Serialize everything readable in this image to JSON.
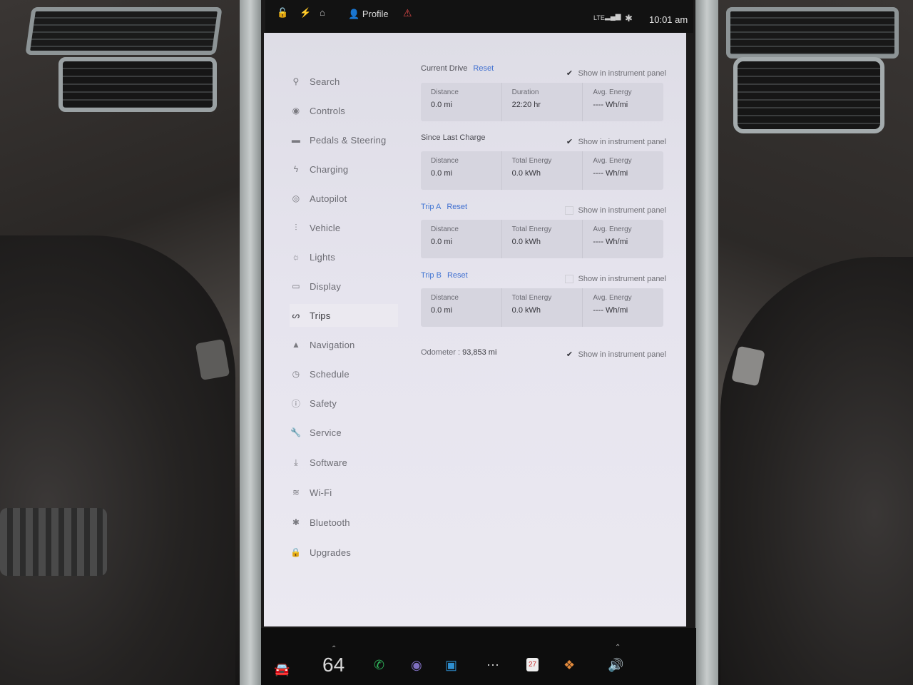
{
  "status_bar": {
    "profile_label": "Profile",
    "network": "LTE",
    "time": "10:01 am"
  },
  "sidebar": {
    "items": [
      {
        "label": "Search",
        "icon": "search-icon"
      },
      {
        "label": "Controls",
        "icon": "toggle-icon"
      },
      {
        "label": "Pedals & Steering",
        "icon": "car-icon"
      },
      {
        "label": "Charging",
        "icon": "bolt-icon"
      },
      {
        "label": "Autopilot",
        "icon": "steering-wheel-icon"
      },
      {
        "label": "Vehicle",
        "icon": "sliders-icon"
      },
      {
        "label": "Lights",
        "icon": "sun-icon"
      },
      {
        "label": "Display",
        "icon": "display-icon"
      },
      {
        "label": "Trips",
        "icon": "trips-icon"
      },
      {
        "label": "Navigation",
        "icon": "navigation-arrow-icon"
      },
      {
        "label": "Schedule",
        "icon": "clock-icon"
      },
      {
        "label": "Safety",
        "icon": "alert-circle-icon"
      },
      {
        "label": "Service",
        "icon": "wrench-icon"
      },
      {
        "label": "Software",
        "icon": "download-icon"
      },
      {
        "label": "Wi-Fi",
        "icon": "wifi-icon"
      },
      {
        "label": "Bluetooth",
        "icon": "bluetooth-icon"
      },
      {
        "label": "Upgrades",
        "icon": "lock-icon"
      }
    ],
    "active": "Trips"
  },
  "trips": {
    "show_label": "Show in instrument panel",
    "current_drive": {
      "title": "Current Drive",
      "reset": "Reset",
      "checked": true,
      "cells": [
        {
          "label": "Distance",
          "value": "0.0 mi"
        },
        {
          "label": "Duration",
          "value": "22:20 hr"
        },
        {
          "label": "Avg. Energy",
          "value": "---- Wh/mi"
        }
      ]
    },
    "since_last_charge": {
      "title": "Since Last Charge",
      "checked": true,
      "cells": [
        {
          "label": "Distance",
          "value": "0.0 mi"
        },
        {
          "label": "Total Energy",
          "value": "0.0 kWh"
        },
        {
          "label": "Avg. Energy",
          "value": "---- Wh/mi"
        }
      ]
    },
    "trip_a": {
      "title": "Trip A",
      "reset": "Reset",
      "checked": false,
      "cells": [
        {
          "label": "Distance",
          "value": "0.0 mi"
        },
        {
          "label": "Total Energy",
          "value": "0.0 kWh"
        },
        {
          "label": "Avg. Energy",
          "value": "---- Wh/mi"
        }
      ]
    },
    "trip_b": {
      "title": "Trip B",
      "reset": "Reset",
      "checked": false,
      "cells": [
        {
          "label": "Distance",
          "value": "0.0 mi"
        },
        {
          "label": "Total Energy",
          "value": "0.0 kWh"
        },
        {
          "label": "Avg. Energy",
          "value": "---- Wh/mi"
        }
      ]
    },
    "odometer": {
      "label": "Odometer :",
      "value": "93,853 mi",
      "checked": true
    }
  },
  "dock": {
    "temperature": "64",
    "calendar_day": "27"
  },
  "colors": {
    "accent": "#3f6fd0",
    "panel_bg": "#e6e4ee",
    "card_bg": "#d6d5df",
    "phone_green": "#2fb35a",
    "warning_red": "#e04848"
  }
}
